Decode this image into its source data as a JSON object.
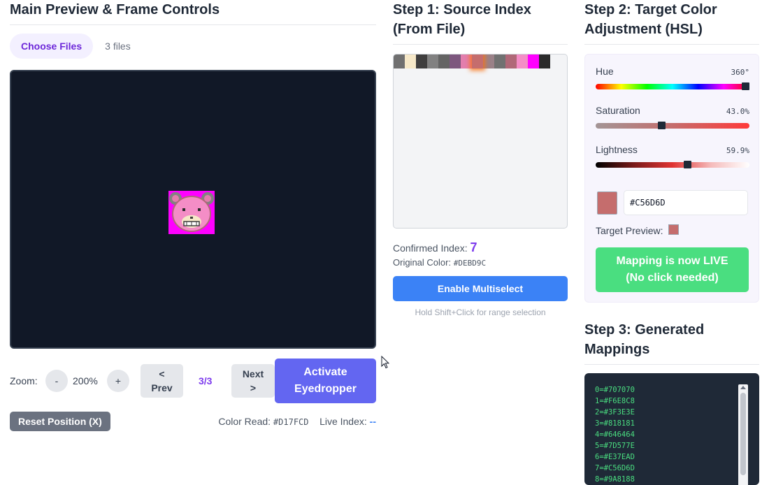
{
  "col1": {
    "title": "Main Preview & Frame Controls",
    "choose_files": "Choose Files",
    "file_count": "3 files",
    "zoom_label": "Zoom:",
    "zoom_minus": "-",
    "zoom_value": "200%",
    "zoom_plus": "+",
    "prev_line1": "<",
    "prev_line2": "Prev",
    "frame_indicator": "3/3",
    "next_line1": "Next",
    "next_line2": ">",
    "eyedropper_line1": "Activate",
    "eyedropper_line2": "Eyedropper",
    "reset_button": "Reset Position (X)",
    "color_read_label": "Color Read:",
    "color_read_value": "#D17FCD",
    "live_index_label": "Live Index:",
    "live_index_value": "--"
  },
  "col2": {
    "title_line1": "Step 1: Source Index",
    "title_line2": "(From File)",
    "palette": [
      "#707070",
      "#F6E8C8",
      "#3F3E3E",
      "#818181",
      "#646464",
      "#7D577E",
      "#E37EAD",
      "#C56D6D",
      "#9A8188",
      "#717171",
      "#B06878",
      "#F48DC6",
      "#FF00FF",
      "#2B2B2B"
    ],
    "selected_swatch": 7,
    "confirmed_label": "Confirmed Index:",
    "confirmed_value": "7",
    "original_label": "Original Color:",
    "original_value": "#DEBD9C",
    "multiselect_button": "Enable Multiselect",
    "hint": "Hold Shift+Click for range selection"
  },
  "col3": {
    "title_line1": "Step 2: Target Color",
    "title_line2": "Adjustment (HSL)",
    "hue_label": "Hue",
    "hue_value": "360°",
    "hue_fraction": 1.0,
    "saturation_label": "Saturation",
    "saturation_value": "43.0%",
    "saturation_fraction": 0.43,
    "lightness_label": "Lightness",
    "lightness_value": "59.9%",
    "lightness_fraction": 0.599,
    "target_color": "#C56D6D",
    "hex_input": "#C56D6D",
    "target_preview_label": "Target Preview:",
    "live_line1": "Mapping is now LIVE",
    "live_line2": "(No click needed)",
    "step3_line1": "Step 3: Generated",
    "step3_line2": "Mappings",
    "mappings": [
      "0=#707070",
      "1=#F6E8C8",
      "2=#3F3E3E",
      "3=#818181",
      "4=#646464",
      "5=#7D577E",
      "6=#E37EAD",
      "7=#C56D6D",
      "8=#9A8188"
    ]
  }
}
